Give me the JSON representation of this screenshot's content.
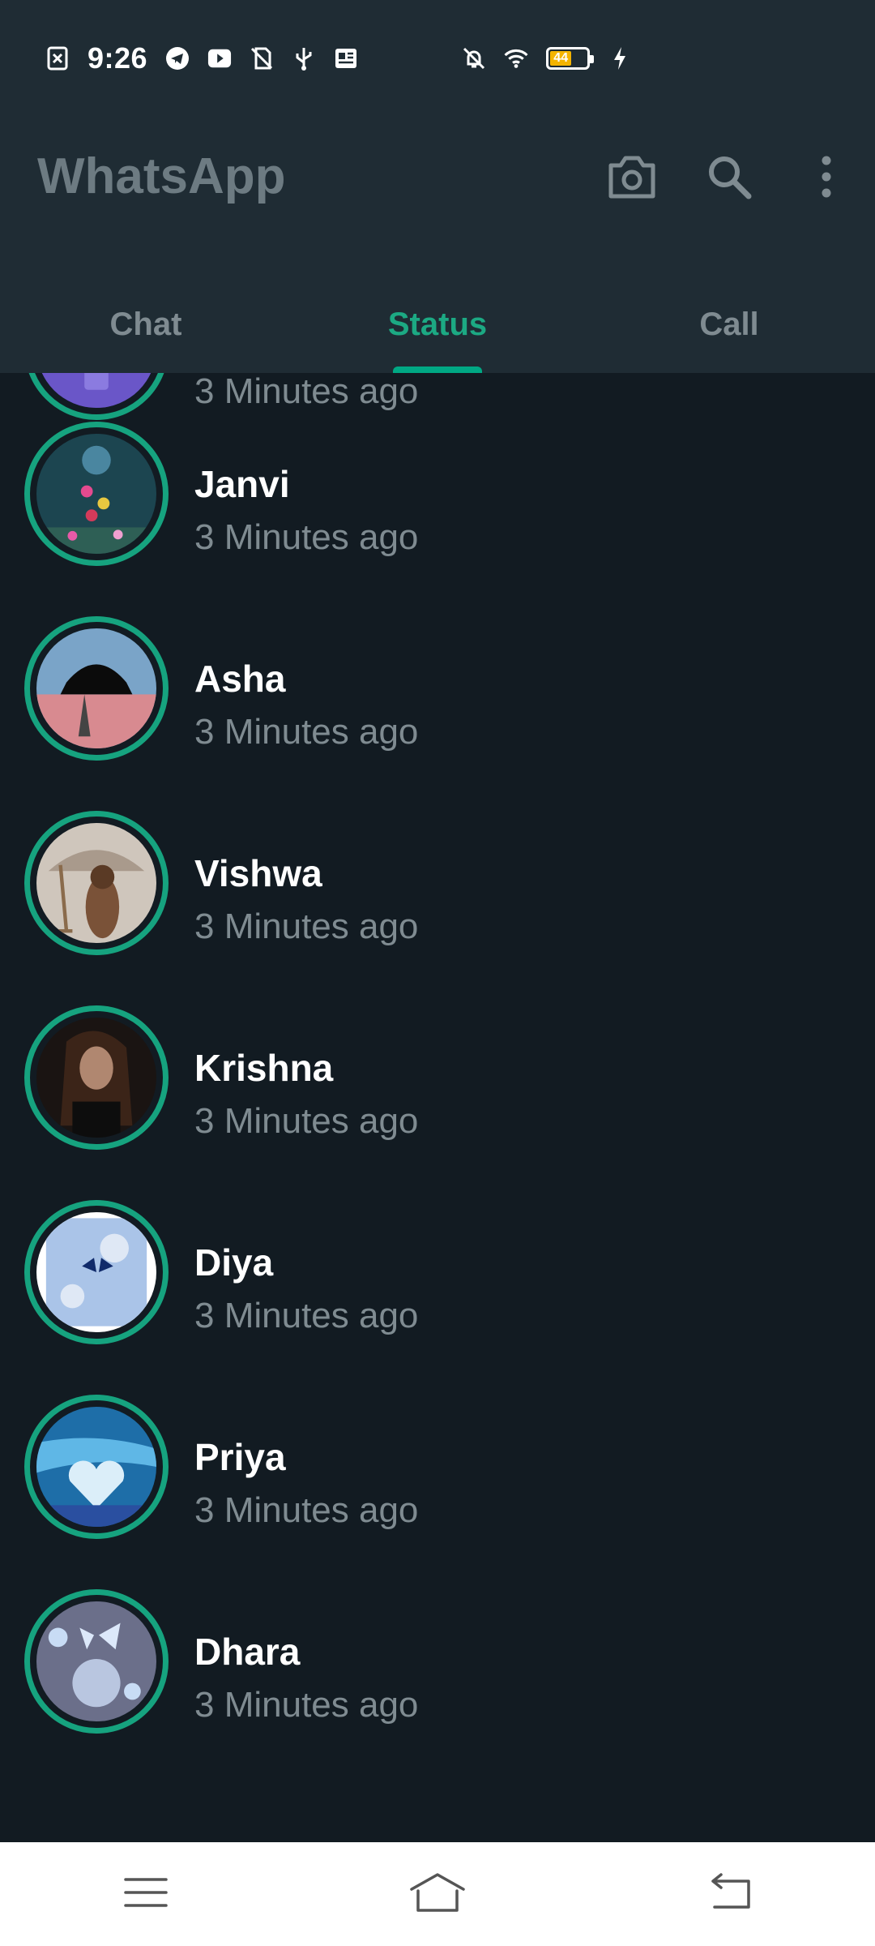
{
  "status_bar": {
    "time": "9:26",
    "battery_level": "44",
    "icons": [
      "screenshot-icon",
      "telegram-icon",
      "youtube-icon",
      "no-sim-icon",
      "usb-icon",
      "news-icon",
      "mute-icon",
      "wifi-icon",
      "battery-icon",
      "charging-icon"
    ]
  },
  "app_bar": {
    "title": "WhatsApp",
    "actions": [
      "camera-icon",
      "search-icon",
      "more-options-icon"
    ]
  },
  "tabs": [
    {
      "label": "Chat",
      "active": false
    },
    {
      "label": "Status",
      "active": true
    },
    {
      "label": "Call",
      "active": false
    }
  ],
  "colors": {
    "accent": "#00a884",
    "ring": "#16a37f",
    "background": "#121b22",
    "header": "#1f2c34"
  },
  "statuses": [
    {
      "name": "",
      "time": "3 Minutes ago"
    },
    {
      "name": "Janvi",
      "time": "3 Minutes ago"
    },
    {
      "name": "Asha",
      "time": "3 Minutes ago"
    },
    {
      "name": "Vishwa",
      "time": "3 Minutes ago"
    },
    {
      "name": "Krishna",
      "time": "3 Minutes ago"
    },
    {
      "name": "Diya",
      "time": "3 Minutes ago"
    },
    {
      "name": "Priya",
      "time": "3 Minutes ago"
    },
    {
      "name": "Dhara",
      "time": "3 Minutes ago"
    }
  ],
  "nav_bar": [
    "menu-icon",
    "home-icon",
    "back-icon"
  ]
}
